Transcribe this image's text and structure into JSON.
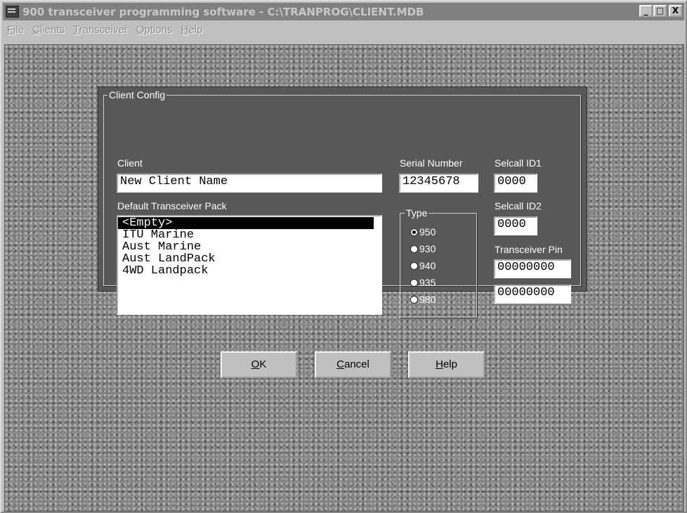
{
  "window": {
    "title": "900 transceiver programming software - C:\\TRANPROG\\CLIENT.MDB",
    "app_icon": "transceiver-app-icon",
    "controls": {
      "minimize": "_",
      "maximize": "□",
      "close": "X"
    }
  },
  "menubar": {
    "items": [
      {
        "label": "File",
        "mnemonic": "F",
        "rest": "ile"
      },
      {
        "label": "Clients",
        "mnemonic": "C",
        "rest": "lients"
      },
      {
        "label": "Transceiver",
        "mnemonic": "T",
        "rest": "ransceiver"
      },
      {
        "label": "Options",
        "mnemonic": "O",
        "rest": "ptions"
      },
      {
        "label": "Help",
        "mnemonic": "H",
        "rest": "elp"
      }
    ]
  },
  "client_config": {
    "group_title": "Client Config",
    "client_label": "Client",
    "client_value": "New Client Name",
    "serial_label": "Serial Number",
    "serial_value": "12345678",
    "selcall1_label": "Selcall ID1",
    "selcall1_value": "0000",
    "selcall2_label": "Selcall ID2",
    "selcall2_value": "0000",
    "pin_label": "Transceiver Pin",
    "pin_value_1": "00000000",
    "pin_value_2": "00000000",
    "pack_label": "Default Transceiver Pack",
    "pack_items": [
      "<Empty>",
      "ITU Marine",
      "Aust Marine",
      "Aust LandPack",
      "4WD Landpack"
    ],
    "pack_selected": "<Empty>",
    "type_title": "Type",
    "type_options": [
      "950",
      "930",
      "940",
      "935",
      "980"
    ],
    "type_selected": "950"
  },
  "buttons": {
    "ok": {
      "mnemonic": "O",
      "rest": "K"
    },
    "cancel": {
      "mnemonic": "C",
      "rest": "ancel"
    },
    "help": {
      "mnemonic": "H",
      "rest": "elp"
    }
  },
  "colors": {
    "titlebar_inactive": "#808080",
    "panel": "#585858",
    "desktop_texture": "#7f7f7f"
  }
}
